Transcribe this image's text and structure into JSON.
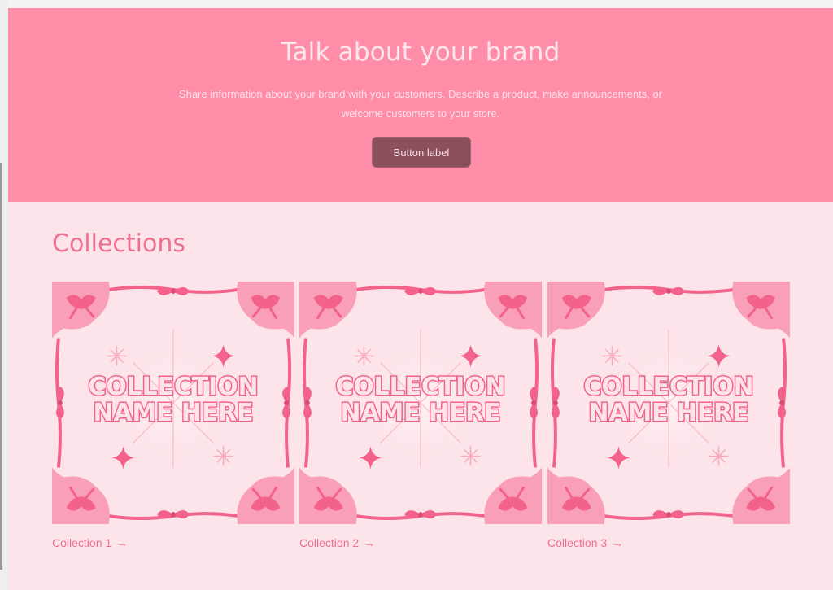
{
  "banner": {
    "title": "Talk about your brand",
    "description": "Share information about your brand with your customers. Describe a product, make announcements, or welcome customers to your store.",
    "button_label": "Button label"
  },
  "collections": {
    "heading": "Collections",
    "image_text_line1": "COLLECTION",
    "image_text_line2": "NAME HERE",
    "items": [
      {
        "label": "Collection 1",
        "arrow": "→"
      },
      {
        "label": "Collection 2",
        "arrow": "→"
      },
      {
        "label": "Collection 3",
        "arrow": "→"
      }
    ]
  },
  "colors": {
    "banner_bg": "#ff8da8",
    "page_bg": "#fde4ea",
    "button_bg": "#8c4f5c",
    "accent": "#f0708f",
    "ribbon": "#f2628a",
    "corner": "#f9a0b8"
  },
  "icons": {
    "sparkle": "sparkle-icon",
    "bow": "bow-icon",
    "arrow": "arrow-right-icon"
  }
}
